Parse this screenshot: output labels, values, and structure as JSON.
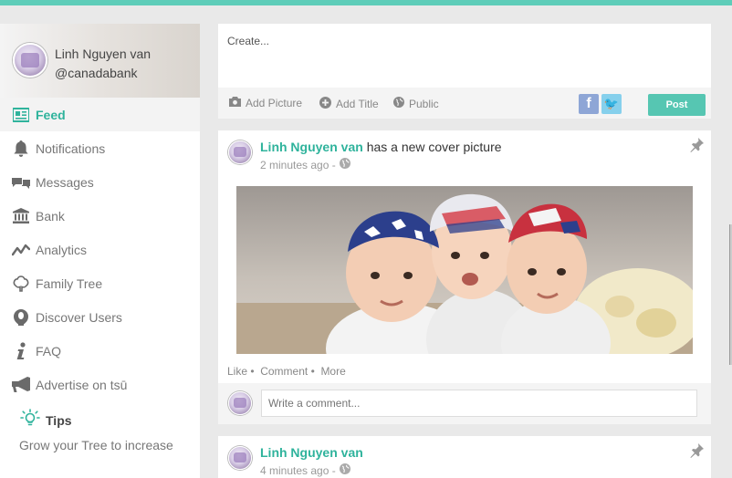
{
  "user": {
    "name": "Linh Nguyen van",
    "handle": "@canadabank"
  },
  "nav": [
    {
      "label": "Feed",
      "icon": "feed-icon",
      "active": true
    },
    {
      "label": "Notifications",
      "icon": "bell-icon"
    },
    {
      "label": "Messages",
      "icon": "chat-icon"
    },
    {
      "label": "Bank",
      "icon": "bank-icon"
    },
    {
      "label": "Analytics",
      "icon": "analytics-icon"
    },
    {
      "label": "Family Tree",
      "icon": "tree-icon"
    },
    {
      "label": "Discover Users",
      "icon": "discover-icon"
    },
    {
      "label": "FAQ",
      "icon": "info-icon"
    },
    {
      "label": "Advertise on tsū",
      "icon": "megaphone-icon"
    }
  ],
  "tips": {
    "title": "Tips",
    "text": "Grow your Tree to increase"
  },
  "composer": {
    "placeholder": "Create...",
    "add_picture": "Add Picture",
    "add_title": "Add Title",
    "privacy": "Public",
    "post_label": "Post"
  },
  "posts": [
    {
      "author": "Linh Nguyen van",
      "action": "has a new cover picture",
      "time": "2 minutes ago -",
      "like": "Like",
      "comment": "Comment",
      "more": "More",
      "comment_placeholder": "Write a comment..."
    },
    {
      "author": "Linh Nguyen van",
      "action": "",
      "time": "4 minutes ago -"
    }
  ],
  "colors": {
    "accent": "#2fb39c",
    "topbar": "#5ecdb9",
    "post_button": "#56c6b2"
  }
}
